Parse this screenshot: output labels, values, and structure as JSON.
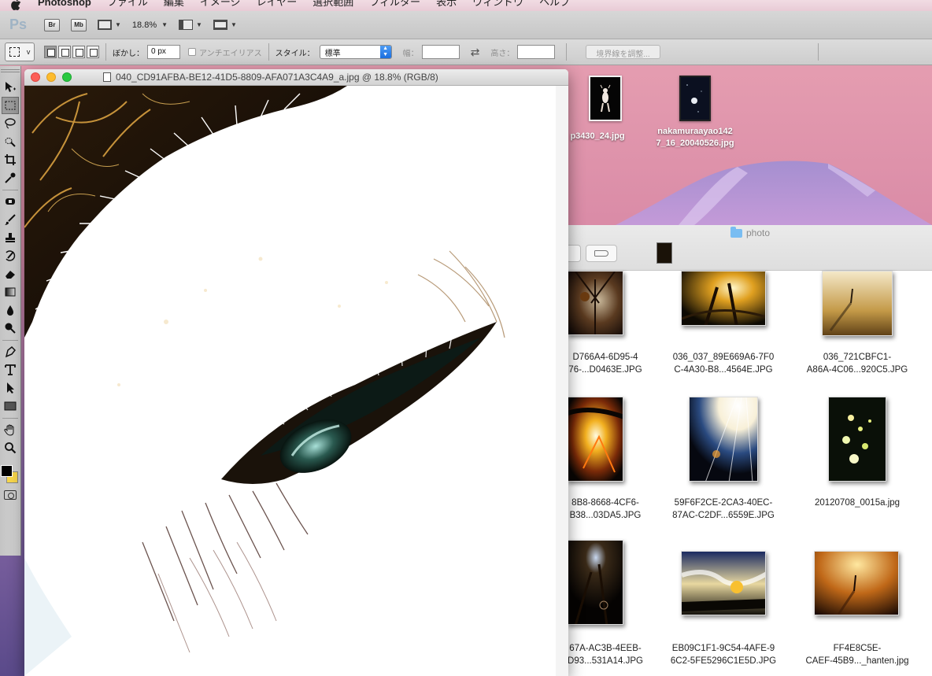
{
  "menubar": {
    "app_name": "Photoshop",
    "items": [
      "ファイル",
      "編集",
      "イメージ",
      "レイヤー",
      "選択範囲",
      "フィルター",
      "表示",
      "ウィンドウ",
      "ヘルプ"
    ]
  },
  "appbar": {
    "ps": "Ps",
    "br": "Br",
    "mb": "Mb",
    "zoom": "18.8%"
  },
  "options": {
    "preset_caret": "v",
    "feather_label": "ぼかし：",
    "feather_value": "0 px",
    "antialias_label": "アンチエイリアス",
    "style_label": "スタイル：",
    "style_value": "標準",
    "width_label": "幅：",
    "height_label": "高さ：",
    "refine_label": "境界線を調整..."
  },
  "document": {
    "title": "040_CD91AFBA-BE12-41D5-8809-AFA071A3C4A9_a.jpg @ 18.8% (RGB/8)"
  },
  "desktop": {
    "icon1_label": "p3430_24.jpg",
    "icon2_label_line1": "nakamuraayao142",
    "icon2_label_line2": "7_16_20040526.jpg"
  },
  "finder": {
    "title": "photo",
    "files": [
      {
        "line1": "D766A4-6D95-4",
        "line2": "76-...D0463E.JPG"
      },
      {
        "line1": "036_037_89E669A6-7F0",
        "line2": "C-4A30-B8...4564E.JPG"
      },
      {
        "line1": "036_721CBFC1-",
        "line2": "A86A-4C06...920C5.JPG"
      },
      {
        "line1": "8B8-8668-4CF6-",
        "line2": "B38...03DA5.JPG"
      },
      {
        "line1": "59F6F2CE-2CA3-40EC-",
        "line2": "87AC-C2DF...6559E.JPG"
      },
      {
        "line1": "20120708_0015a.jpg",
        "line2": ""
      },
      {
        "line1": "67A-AC3B-4EEB-",
        "line2": "D93...531A14.JPG"
      },
      {
        "line1": "EB09C1F1-9C54-4AFE-9",
        "line2": "6C2-5FE5296C1E5D.JPG"
      },
      {
        "line1": "FF4E8C5E-",
        "line2": "CAEF-45B9..._hanten.jpg"
      }
    ]
  },
  "colors": {
    "foreground": "#000000",
    "background": "#f8d74c",
    "select_accent": "#1a6fe0"
  }
}
